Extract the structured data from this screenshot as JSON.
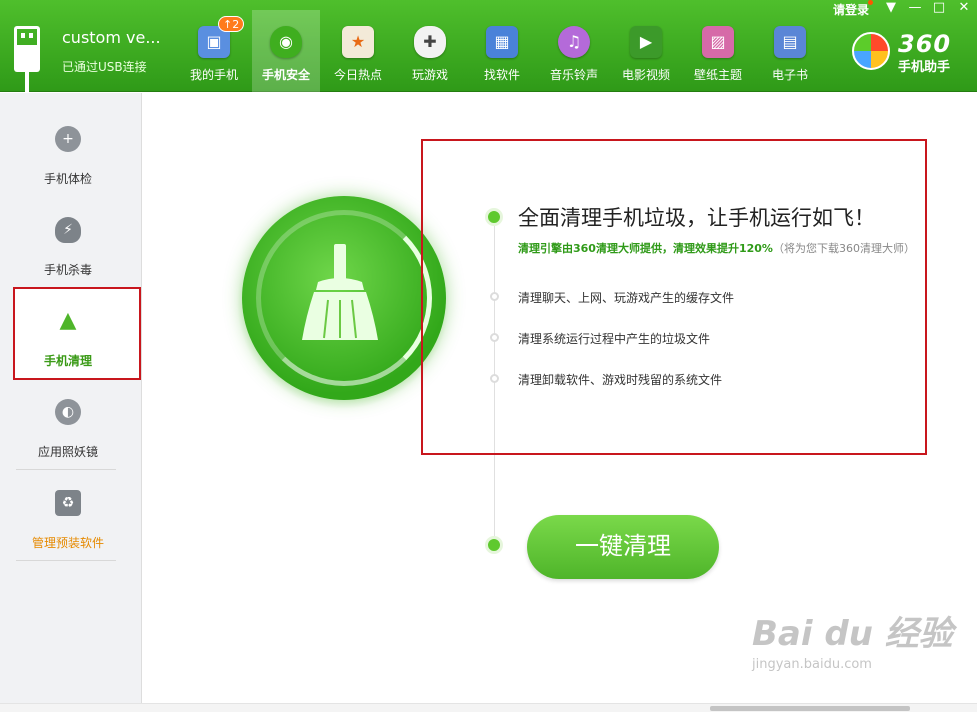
{
  "device": {
    "name": "custom ve...",
    "status": "已通过USB连接"
  },
  "nav": {
    "items": [
      {
        "label": "我的手机",
        "icon": "android-phone-icon",
        "badge": "↑2",
        "color": "#5a8fe0",
        "glyph": "▣"
      },
      {
        "label": "手机安全",
        "icon": "shield-icon",
        "active": true,
        "color": "#3fae1f",
        "glyph": "◉"
      },
      {
        "label": "今日热点",
        "icon": "star-news-icon",
        "color": "#e8e0d0",
        "glyph": "★"
      },
      {
        "label": "玩游戏",
        "icon": "gamepad-icon",
        "color": "#f2f2f2",
        "glyph": "✚"
      },
      {
        "label": "找软件",
        "icon": "app-bag-icon",
        "color": "#4a82d9",
        "glyph": "▦"
      },
      {
        "label": "音乐铃声",
        "icon": "music-icon",
        "color": "#b46ad9",
        "glyph": "♫"
      },
      {
        "label": "电影视频",
        "icon": "film-icon",
        "color": "#3c9a2a",
        "glyph": "▶"
      },
      {
        "label": "壁纸主题",
        "icon": "wallpaper-icon",
        "color": "#d66aa8",
        "glyph": "▨"
      },
      {
        "label": "电子书",
        "icon": "ebook-icon",
        "color": "#5a86d6",
        "glyph": "▤"
      }
    ]
  },
  "titlebar": {
    "login": "请登录",
    "menu_glyph": "▼",
    "min_glyph": "—",
    "max_glyph": "□",
    "close_glyph": "✕"
  },
  "brand": {
    "number": "360",
    "name": "手机助手"
  },
  "sidebar": {
    "items": [
      {
        "label": "手机体检",
        "icon": "health-check-icon",
        "glyph": "+"
      },
      {
        "label": "手机杀毒",
        "icon": "antivirus-shield-icon",
        "glyph": "⚡"
      },
      {
        "label": "手机清理",
        "icon": "broom-icon",
        "glyph": "▲",
        "active": true
      },
      {
        "label": "应用照妖镜",
        "icon": "app-mirror-icon",
        "glyph": "◐"
      },
      {
        "label": "管理预装软件",
        "icon": "preinstalled-trash-icon",
        "glyph": "♻",
        "warn": true
      }
    ]
  },
  "main": {
    "headline": "全面清理手机垃圾，让手机运行如飞！",
    "sub_green": "清理引擎由360清理大师提供，清理效果提升120%",
    "sub_gray": "（将为您下载360清理大师）",
    "bullets": [
      "清理聊天、上网、玩游戏产生的缓存文件",
      "清理系统运行过程中产生的垃圾文件",
      "清理卸载软件、游戏时残留的系统文件"
    ],
    "clean_button": "一键清理"
  },
  "watermark": {
    "main": "Bai du 经验",
    "sub": "jingyan.baidu.com"
  }
}
